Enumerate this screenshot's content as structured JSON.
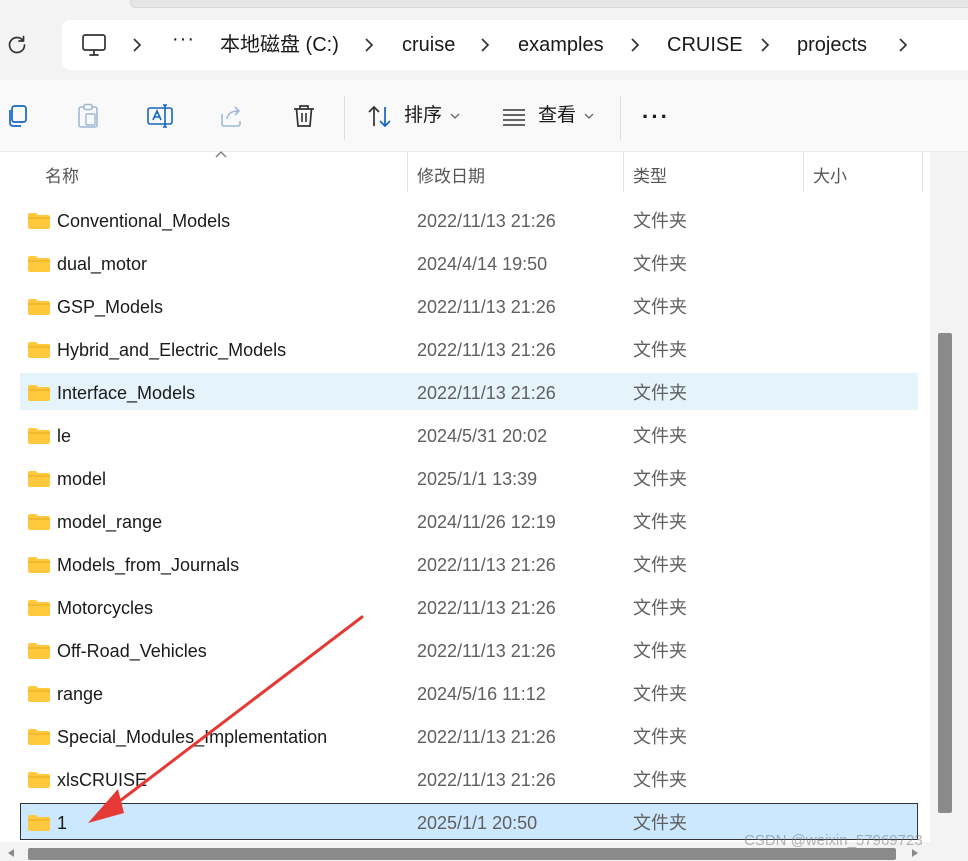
{
  "breadcrumb": {
    "overflow": "···",
    "items": [
      "本地磁盘 (C:)",
      "cruise",
      "examples",
      "CRUISE",
      "projects"
    ]
  },
  "toolbar": {
    "sort_label": "排序",
    "view_label": "查看",
    "more_label": "···"
  },
  "columns": {
    "name": "名称",
    "date": "修改日期",
    "type": "类型",
    "size": "大小"
  },
  "files": [
    {
      "name": "Conventional_Models",
      "date": "2022/11/13 21:26",
      "type": "文件夹"
    },
    {
      "name": "dual_motor",
      "date": "2024/4/14 19:50",
      "type": "文件夹"
    },
    {
      "name": "GSP_Models",
      "date": "2022/11/13 21:26",
      "type": "文件夹"
    },
    {
      "name": "Hybrid_and_Electric_Models",
      "date": "2022/11/13 21:26",
      "type": "文件夹"
    },
    {
      "name": "Interface_Models",
      "date": "2022/11/13 21:26",
      "type": "文件夹"
    },
    {
      "name": "le",
      "date": "2024/5/31 20:02",
      "type": "文件夹"
    },
    {
      "name": "model",
      "date": "2025/1/1 13:39",
      "type": "文件夹"
    },
    {
      "name": "model_range",
      "date": "2024/11/26 12:19",
      "type": "文件夹"
    },
    {
      "name": "Models_from_Journals",
      "date": "2022/11/13 21:26",
      "type": "文件夹"
    },
    {
      "name": "Motorcycles",
      "date": "2022/11/13 21:26",
      "type": "文件夹"
    },
    {
      "name": "Off-Road_Vehicles",
      "date": "2022/11/13 21:26",
      "type": "文件夹"
    },
    {
      "name": "range",
      "date": "2024/5/16 11:12",
      "type": "文件夹"
    },
    {
      "name": "Special_Modules_Implementation",
      "date": "2022/11/13 21:26",
      "type": "文件夹"
    },
    {
      "name": "xlsCRUISE",
      "date": "2022/11/13 21:26",
      "type": "文件夹"
    },
    {
      "name": "1",
      "date": "2025/1/1 20:50",
      "type": "文件夹"
    }
  ],
  "hovered_row": 4,
  "selected_row": 14,
  "watermark": "CSDN @weixin_57969723",
  "colors": {
    "folder": "#ffc83d",
    "selection": "#cce8ff",
    "hover": "#e5f3fb",
    "annotation_arrow": "#e53935"
  }
}
